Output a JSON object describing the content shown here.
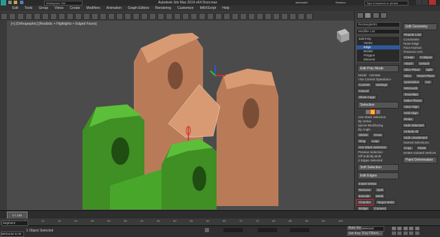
{
  "window": {
    "title": "Autodesk 3ds Max 2014 x64    Door.max",
    "workspace": "Workspace: Def",
    "search_placeholder": "Type a keyword or phrase",
    "user_a": "Sesmoo",
    "user_b": "kerimodel"
  },
  "menu": [
    "Edit",
    "Tools",
    "Group",
    "Views",
    "Create",
    "Modifiers",
    "Animation",
    "Graph Editors",
    "Rendering",
    "Customize",
    "MAXScript",
    "Help"
  ],
  "viewport": {
    "label": "[+] [Orthographic] [Realistic + Highlights + Edged Faces]"
  },
  "command_panel": {
    "object_name": "Rectangle001",
    "modifier_list": "Modifier List",
    "stack": [
      "Edit Poly",
      "Vertex",
      "Edge",
      "Border",
      "Polygon",
      "Element"
    ],
    "selection_header": "Edit Poly Mode",
    "model_label": "Model",
    "animate_label": "Animate",
    "no_current_op": "<No Current Operation>",
    "commit": "Commit",
    "settings": "Settings",
    "cancel": "Cancel",
    "show_cage": "Show Cage",
    "sel_header": "Selection",
    "use_stack": "Use Stack Selection",
    "by_vertex": "By Vertex",
    "ignore_backfacing": "Ignore Backfacing",
    "by_angle": "By Angle",
    "shrink": "Shrink",
    "grow": "Grow",
    "ring": "Ring",
    "loop": "Loop",
    "get_stack_sel": "Get Stack Selection",
    "preview_sel": "Preview Selection",
    "off": "Off",
    "subobj": "SubObj",
    "multi": "Multi",
    "selected_status": "2 Edges Selected",
    "soft_sel": "Soft Selection",
    "edit_edges": "Edit Edges",
    "insert_vertex": "Insert Vertex",
    "remove": "Remove",
    "split": "Split",
    "extrude": "Extrude",
    "weld": "Weld",
    "chamfer": "Chamfer",
    "target_weld": "Target Weld",
    "bridge": "Bridge",
    "connect": "Connect",
    "create_shape": "Create Shape",
    "edit_tri": "Edit Tri.",
    "turn": "Turn"
  },
  "command_panel_right": {
    "edit_geometry": "Edit Geometry",
    "repeat_last": "Repeat Last",
    "constraints": "Constraints",
    "none": "None",
    "edge": "Edge",
    "face": "Face",
    "normal": "Normal",
    "preserve_uvs": "Preserve UVs",
    "create": "Create",
    "collapse": "Collapse",
    "attach": "Attach",
    "detach": "Detach",
    "slice_plane": "Slice Plane",
    "split": "Split",
    "slice": "Slice",
    "reset_plane": "Reset Plane",
    "quickslice": "QuickSlice",
    "cut": "Cut",
    "msmooth": "MSmooth",
    "tessellate": "Tessellate",
    "make_planar": "Make Planar",
    "view_align": "View Align",
    "grid_align": "Grid Align",
    "relax": "Relax",
    "hide_selected": "Hide Selected",
    "unhide_all": "Unhide All",
    "hide_unselected": "Hide Unselected",
    "named_selections": "Named Selections:",
    "copy": "Copy",
    "paste": "Paste",
    "delete_isolated": "Delete Isolated Vertices",
    "paint_deformation": "Paint Deformation"
  },
  "timeline": {
    "frame": "0 / 100",
    "ticks": [
      "0",
      "5",
      "10",
      "15",
      "20",
      "25",
      "30",
      "35",
      "40",
      "45",
      "50",
      "55",
      "60",
      "65",
      "70",
      "75",
      "80",
      "85",
      "90",
      "95",
      "100"
    ]
  },
  "status": {
    "selection_set": "Segment",
    "objects_selected": "1 Object Selected",
    "welcome": "Welcome to M",
    "selected_label": "Selected",
    "autokey": "Auto Key",
    "setkey": "Set Key",
    "keyfilters": "Key Filters..."
  },
  "colors": {
    "orange_object": "#c98e66",
    "green_object": "#48a72a",
    "selection_red": "#e0243c",
    "viewport_bg": "#4b4b4b"
  }
}
